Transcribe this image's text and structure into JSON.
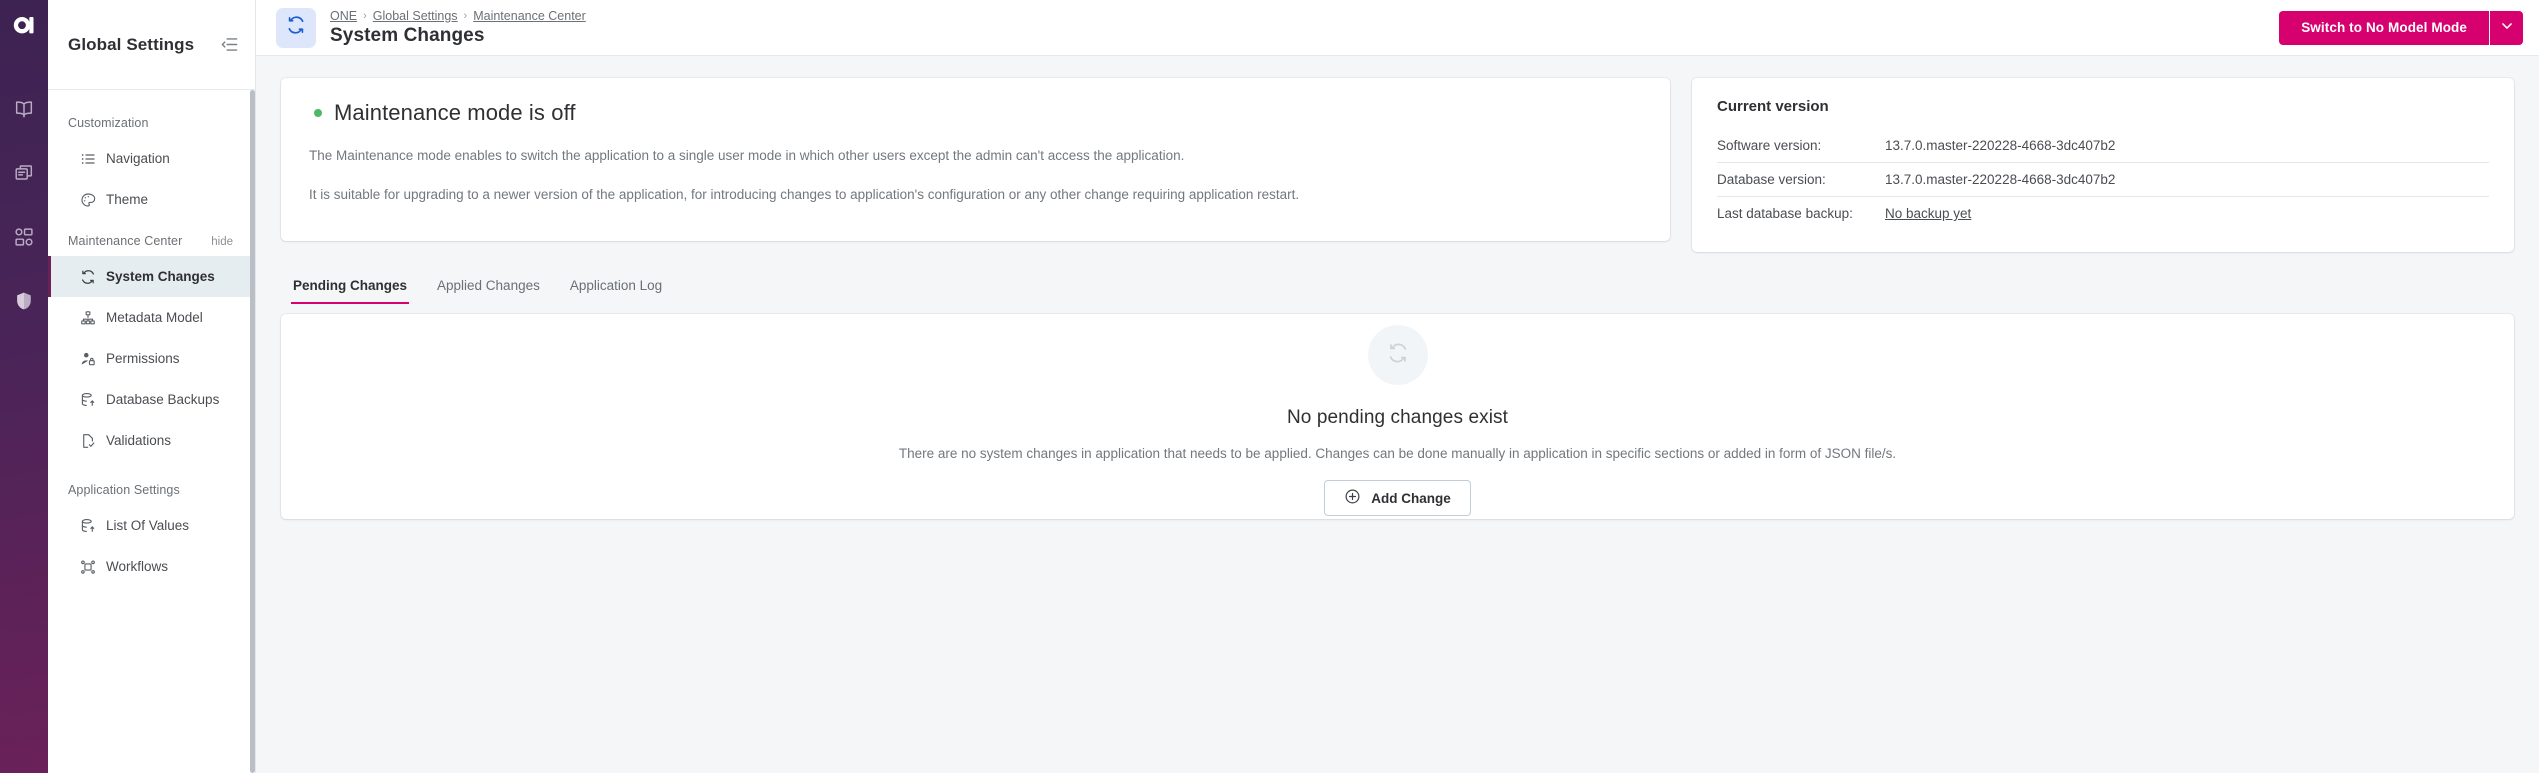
{
  "rail": {
    "logo_icon": "app-logo-icon",
    "items": [
      {
        "icon": "book-icon",
        "name": "rail-item-documentation"
      },
      {
        "icon": "folders-icon",
        "name": "rail-item-catalog"
      },
      {
        "icon": "dashboard-icon",
        "name": "rail-item-dashboards"
      },
      {
        "icon": "shield-icon",
        "name": "rail-item-security"
      }
    ]
  },
  "sidebar": {
    "title": "Global Settings",
    "collapse_icon": "collapse-panel-icon",
    "groups": [
      {
        "label": "Customization",
        "hide_label": null,
        "items": [
          {
            "label": "Navigation",
            "icon": "list-icon",
            "active": false
          },
          {
            "label": "Theme",
            "icon": "palette-icon",
            "active": false
          }
        ]
      },
      {
        "label": "Maintenance Center",
        "hide_label": "hide",
        "items": [
          {
            "label": "System Changes",
            "icon": "refresh-icon",
            "active": true
          },
          {
            "label": "Metadata Model",
            "icon": "hierarchy-icon",
            "active": false
          },
          {
            "label": "Permissions",
            "icon": "user-lock-icon",
            "active": false
          },
          {
            "label": "Database Backups",
            "icon": "database-upload-icon",
            "active": false
          },
          {
            "label": "Validations",
            "icon": "file-check-icon",
            "active": false
          }
        ]
      },
      {
        "label": "Application Settings",
        "hide_label": null,
        "items": [
          {
            "label": "List Of Values",
            "icon": "database-upload-icon",
            "active": false
          },
          {
            "label": "Workflows",
            "icon": "workflow-icon",
            "active": false
          }
        ]
      }
    ]
  },
  "topbar": {
    "page_icon": "refresh-icon",
    "breadcrumb": [
      "ONE",
      "Global Settings",
      "Maintenance Center"
    ],
    "breadcrumb_separator": "›",
    "page_title": "System Changes",
    "switch_mode_button": "Switch to No Model Mode",
    "switch_mode_caret_icon": "chevron-down-icon"
  },
  "maintenance_card": {
    "status_dot_color": "#4cb964",
    "title": "Maintenance mode is off",
    "paragraphs": [
      "The Maintenance mode enables to switch the application to a single user mode in which other users except the admin can't access the application.",
      "It is suitable for upgrading to a newer version of the application, for introducing changes to application's configuration or any other change requiring application restart."
    ]
  },
  "version_card": {
    "title": "Current version",
    "rows": [
      {
        "label": "Software version:",
        "value": "13.7.0.master-220228-4668-3dc407b2",
        "link": false
      },
      {
        "label": "Database version:",
        "value": "13.7.0.master-220228-4668-3dc407b2",
        "link": false
      },
      {
        "label": "Last database backup:",
        "value": "No backup yet",
        "link": true
      }
    ]
  },
  "tabs": [
    {
      "label": "Pending Changes",
      "active": true
    },
    {
      "label": "Applied Changes",
      "active": false
    },
    {
      "label": "Application Log",
      "active": false
    }
  ],
  "empty_state": {
    "icon": "refresh-icon",
    "title": "No pending changes exist",
    "description": "There are no system changes in application that needs to be applied. Changes can be done manually in application in specific sections or added in form of JSON file/s.",
    "button_label": "Add Change",
    "button_icon": "plus-circle-icon"
  },
  "colors": {
    "accent_pink": "#d6006e",
    "rail_purple": "#4a2458",
    "active_nav_bg": "#e6edf1",
    "status_green": "#4cb964",
    "page_icon_bg": "#dde6fb"
  }
}
